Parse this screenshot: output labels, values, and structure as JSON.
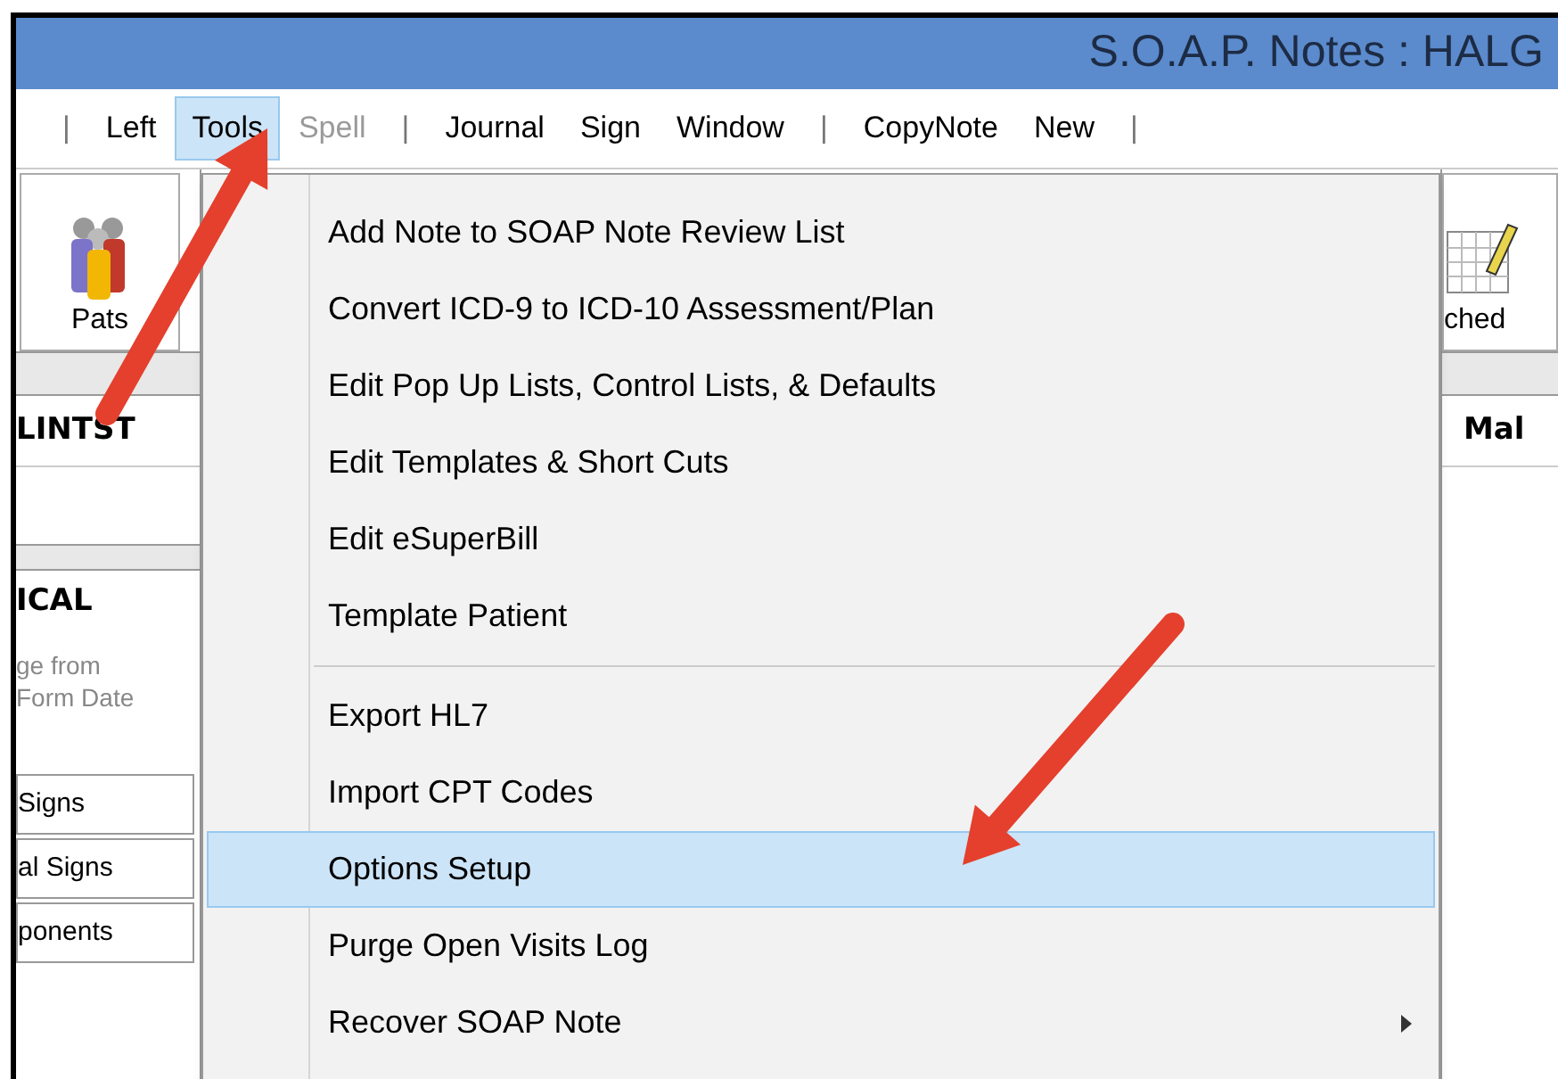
{
  "window": {
    "title": "S.O.A.P.  Notes : HALG"
  },
  "menu_bar": [
    {
      "kind": "separator",
      "label": "|"
    },
    {
      "kind": "item",
      "label": "Left",
      "selected": false,
      "disabled": false
    },
    {
      "kind": "item",
      "label": "Tools",
      "selected": true,
      "disabled": false
    },
    {
      "kind": "item",
      "label": "Spell",
      "selected": false,
      "disabled": true
    },
    {
      "kind": "separator",
      "label": "|"
    },
    {
      "kind": "item",
      "label": "Journal",
      "selected": false,
      "disabled": false
    },
    {
      "kind": "item",
      "label": "Sign",
      "selected": false,
      "disabled": false
    },
    {
      "kind": "item",
      "label": "Window",
      "selected": false,
      "disabled": false
    },
    {
      "kind": "separator",
      "label": "|"
    },
    {
      "kind": "item",
      "label": "CopyNote",
      "selected": false,
      "disabled": false
    },
    {
      "kind": "item",
      "label": "New",
      "selected": false,
      "disabled": false
    },
    {
      "kind": "separator",
      "label": "|"
    }
  ],
  "toolbar": {
    "left_button": "Pats",
    "right_button": "ched"
  },
  "patient_header": {
    "name": "LINTST",
    "sex": "Mal"
  },
  "left_panel": {
    "heading": "ICAL",
    "note_lines": [
      "ge from",
      "Form Date"
    ],
    "buttons": [
      "Signs",
      "al Signs",
      "ponents"
    ]
  },
  "tools_menu": [
    {
      "kind": "item",
      "label": "Add Note to SOAP Note Review List",
      "selected": false,
      "submenu": false
    },
    {
      "kind": "item",
      "label": "Convert ICD-9 to ICD-10 Assessment/Plan",
      "selected": false,
      "submenu": false
    },
    {
      "kind": "item",
      "label": "Edit Pop Up Lists, Control Lists, & Defaults",
      "selected": false,
      "submenu": false
    },
    {
      "kind": "item",
      "label": "Edit Templates & Short Cuts",
      "selected": false,
      "submenu": false
    },
    {
      "kind": "item",
      "label": "Edit eSuperBill",
      "selected": false,
      "submenu": false
    },
    {
      "kind": "item",
      "label": "Template  Patient",
      "selected": false,
      "submenu": false
    },
    {
      "kind": "separator"
    },
    {
      "kind": "item",
      "label": "Export HL7",
      "selected": false,
      "submenu": false
    },
    {
      "kind": "item",
      "label": "Import CPT Codes",
      "selected": false,
      "submenu": false
    },
    {
      "kind": "item",
      "label": "Options Setup",
      "selected": true,
      "submenu": false
    },
    {
      "kind": "item",
      "label": "Purge Open Visits Log",
      "selected": false,
      "submenu": false
    },
    {
      "kind": "item",
      "label": "Recover SOAP Note",
      "selected": false,
      "submenu": true
    }
  ]
}
